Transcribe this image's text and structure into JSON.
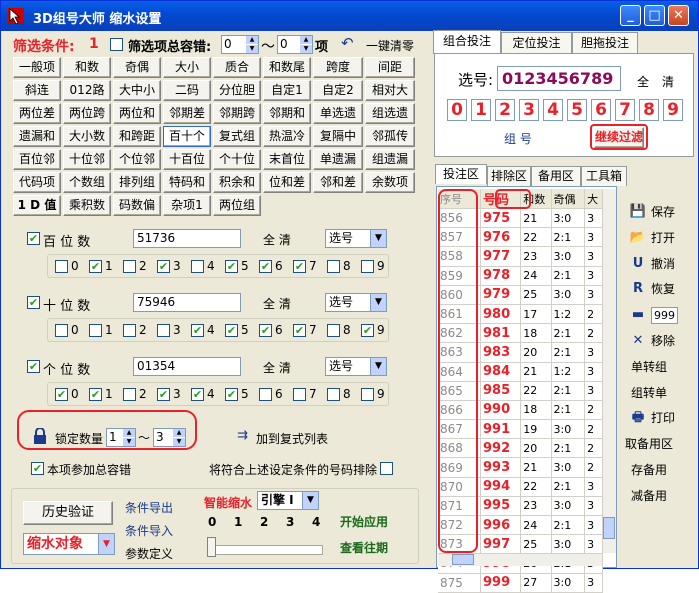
{
  "window": {
    "title": "3D组号大师  缩水设置"
  },
  "filter": {
    "title": "筛选条件:",
    "count": "1",
    "total_tolerance_label": "筛选项总容错:",
    "tol_min": "0",
    "tol_sep": "～",
    "tol_max": "0",
    "tol_unit": "项",
    "clear_all": "一键清零"
  },
  "cond_rows": [
    [
      "一般项",
      "和数",
      "奇偶",
      "大小",
      "质合",
      "和数尾",
      "跨度",
      "间距"
    ],
    [
      "斜连",
      "012路",
      "大中小",
      "二码",
      "分位胆",
      "自定1",
      "自定2",
      "相对大"
    ],
    [
      "两位差",
      "两位跨",
      "两位和",
      "邻期差",
      "邻期跨",
      "邻期和",
      "单选遗",
      "组选遗"
    ],
    [
      "遗漏和",
      "大小数",
      "和跨距",
      "百十个",
      "复式组",
      "热温冷",
      "复隔中",
      "邻孤传"
    ],
    [
      "百位邻",
      "十位邻",
      "个位邻",
      "十百位",
      "个十位",
      "末首位",
      "单遗漏",
      "组遗漏"
    ],
    [
      "代码项",
      "个数组",
      "排列组",
      "特码和",
      "积余和",
      "位和差",
      "邻和差",
      "余数项"
    ],
    [
      "1 D 值",
      "乘积数",
      "码数偏",
      "杂项1",
      "两位组"
    ]
  ],
  "positions": [
    {
      "label": "百  位  数",
      "value": "51736",
      "clear": "全  清",
      "mode": "选号",
      "digits": [
        false,
        true,
        false,
        true,
        false,
        true,
        true,
        true,
        false,
        false
      ]
    },
    {
      "label": "十  位  数",
      "value": "75946",
      "clear": "全  清",
      "mode": "选号",
      "digits": [
        false,
        false,
        false,
        false,
        true,
        true,
        true,
        true,
        false,
        true
      ]
    },
    {
      "label": "个  位  数",
      "value": "01354",
      "clear": "全  清",
      "mode": "选号",
      "digits": [
        true,
        true,
        false,
        true,
        true,
        true,
        false,
        false,
        false,
        false
      ]
    }
  ],
  "digit_labels": [
    "0",
    "1",
    "2",
    "3",
    "4",
    "5",
    "6",
    "7",
    "8",
    "9"
  ],
  "lock": {
    "label": "锁定数量",
    "min": "1",
    "sep": "～",
    "max": "3",
    "add_label": "加到复式列表"
  },
  "tolerance_include": "本项参加总容错",
  "exclude_label": "将符合上述设定条件的号码排除",
  "bottom": {
    "history_btn": "历史验证",
    "export": "条件导出",
    "import": "条件导入",
    "params": "参数定义",
    "target": "缩水对象",
    "smart": "智能缩水",
    "engine": "引擎 I",
    "scale": [
      "0",
      "1",
      "2",
      "3",
      "4"
    ],
    "apply": "开始应用",
    "view": "查看往期"
  },
  "right": {
    "tabs": [
      "组合投注",
      "定位投注",
      "胆拖投注"
    ],
    "pick_label": "选号:",
    "pick_value": "0123456789",
    "all": "全",
    "clear": "清",
    "digits": [
      "0",
      "1",
      "2",
      "3",
      "4",
      "5",
      "6",
      "7",
      "8",
      "9"
    ],
    "group_btn": "组 号",
    "continue_btn": "继续过滤",
    "sub_tabs": [
      "投注区",
      "排除区",
      "备用区",
      "工具箱"
    ],
    "table_headers": [
      "序号",
      "号码",
      "和数",
      "奇偶",
      "大"
    ],
    "rows": [
      [
        "856",
        "975",
        "21",
        "3:0",
        "3"
      ],
      [
        "857",
        "976",
        "22",
        "2:1",
        "3"
      ],
      [
        "858",
        "977",
        "23",
        "3:0",
        "3"
      ],
      [
        "859",
        "978",
        "24",
        "2:1",
        "3"
      ],
      [
        "860",
        "979",
        "25",
        "3:0",
        "3"
      ],
      [
        "861",
        "980",
        "17",
        "1:2",
        "2"
      ],
      [
        "862",
        "981",
        "18",
        "2:1",
        "2"
      ],
      [
        "863",
        "983",
        "20",
        "2:1",
        "3"
      ],
      [
        "864",
        "984",
        "21",
        "1:2",
        "3"
      ],
      [
        "865",
        "985",
        "22",
        "2:1",
        "3"
      ],
      [
        "866",
        "990",
        "18",
        "2:1",
        "2"
      ],
      [
        "867",
        "991",
        "19",
        "3:0",
        "2"
      ],
      [
        "868",
        "992",
        "20",
        "2:1",
        "2"
      ],
      [
        "869",
        "993",
        "21",
        "3:0",
        "2"
      ],
      [
        "870",
        "994",
        "22",
        "2:1",
        "3"
      ],
      [
        "871",
        "995",
        "23",
        "3:0",
        "3"
      ],
      [
        "872",
        "996",
        "24",
        "2:1",
        "3"
      ],
      [
        "873",
        "997",
        "25",
        "3:0",
        "3"
      ],
      [
        "874",
        "998",
        "26",
        "2:1",
        "3"
      ],
      [
        "875",
        "999",
        "27",
        "3:0",
        "3"
      ]
    ],
    "tools": [
      "保存",
      "打开",
      "撤消",
      "恢复",
      "999",
      "移除",
      "单转组",
      "组转单",
      "打印",
      "取备用区",
      "存备用",
      "减备用"
    ]
  },
  "colors": {
    "accent": "#e8222a",
    "title": "#0349d1"
  }
}
